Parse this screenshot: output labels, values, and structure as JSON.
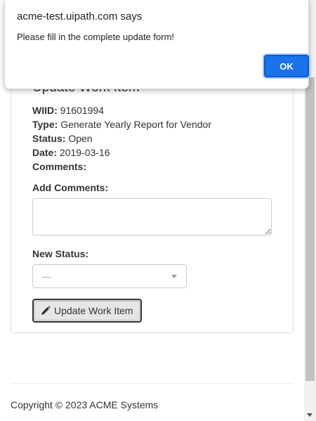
{
  "dialog": {
    "title": "acme-test.uipath.com says",
    "message": "Please fill in the complete update form!",
    "ok_label": "OK"
  },
  "panel": {
    "title": "Update Work Item",
    "fields": {
      "wiid_label": "WIID:",
      "wiid_value": "91601994",
      "type_label": "Type:",
      "type_value": "Generate Yearly Report for Vendor",
      "status_label": "Status:",
      "status_value": "Open",
      "date_label": "Date:",
      "date_value": "2019-03-16",
      "comments_label": "Comments:"
    },
    "add_comments_label": "Add Comments:",
    "add_comments_value": "",
    "new_status_label": "New Status:",
    "new_status_selected": "---",
    "update_button_label": "Update Work Item"
  },
  "footer": {
    "copyright": "Copyright © 2023 ACME Systems"
  },
  "icons": {
    "update_button_icon": "pencil-icon",
    "select_icon": "chevron-down-icon"
  },
  "colors": {
    "ok_button": "#1a73e8",
    "update_button_bg": "#e6e6e6"
  }
}
